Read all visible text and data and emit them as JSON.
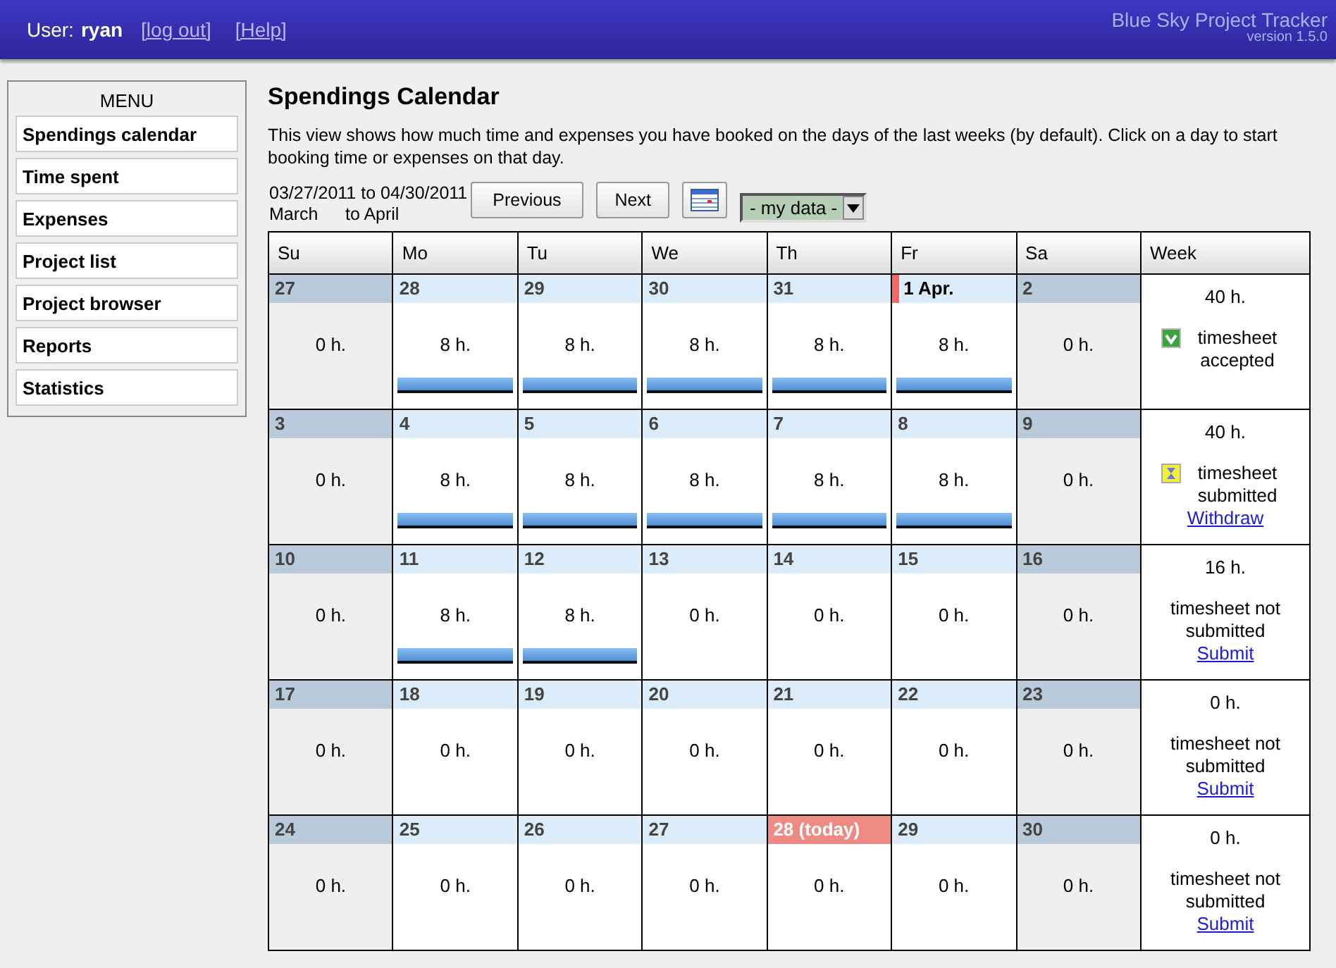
{
  "header": {
    "user_label": "User:",
    "user": "ryan",
    "links": [
      "[log out]",
      "[Help]"
    ],
    "app_name": "Blue Sky Project Tracker",
    "version": "version 1.5.0"
  },
  "menu": {
    "title": "MENU",
    "items": [
      "Spendings calendar",
      "Time spent",
      "Expenses",
      "Project list",
      "Project browser",
      "Reports",
      "Statistics"
    ]
  },
  "page": {
    "title": "Spendings Calendar",
    "description": "This view shows how much time and expenses you have booked on the days of the last weeks (by default). Click on a day to start booking time or expenses on that day."
  },
  "range": {
    "dates": "03/27/2011 to 04/30/2011",
    "from_month": "March",
    "to_month": "to April"
  },
  "buttons": [
    "Previous",
    "Next"
  ],
  "filter": {
    "value": "- my data -"
  },
  "columns": [
    "Su",
    "Mo",
    "Tu",
    "We",
    "Th",
    "Fr",
    "Sa",
    "Week"
  ],
  "weeks": [
    {
      "days": [
        {
          "date": "27",
          "kind": "weekend",
          "hours": "0 h.",
          "booked": false
        },
        {
          "date": "28",
          "kind": "weekday",
          "hours": "8 h.",
          "booked": true
        },
        {
          "date": "29",
          "kind": "weekday",
          "hours": "8 h.",
          "booked": true
        },
        {
          "date": "30",
          "kind": "weekday",
          "hours": "8 h.",
          "booked": true
        },
        {
          "date": "31",
          "kind": "weekday",
          "hours": "8 h.",
          "booked": true
        },
        {
          "date": "1 Apr.",
          "kind": "month_start",
          "hours": "8 h.",
          "booked": true
        },
        {
          "date": "2",
          "kind": "weekend",
          "hours": "0 h.",
          "booked": false
        }
      ],
      "total": "40 h.",
      "kind": "accepted",
      "status_text": "timesheet accepted"
    },
    {
      "days": [
        {
          "date": "3",
          "kind": "weekend",
          "hours": "0 h.",
          "booked": false
        },
        {
          "date": "4",
          "kind": "weekday",
          "hours": "8 h.",
          "booked": true
        },
        {
          "date": "5",
          "kind": "weekday",
          "hours": "8 h.",
          "booked": true
        },
        {
          "date": "6",
          "kind": "weekday",
          "hours": "8 h.",
          "booked": true
        },
        {
          "date": "7",
          "kind": "weekday",
          "hours": "8 h.",
          "booked": true
        },
        {
          "date": "8",
          "kind": "weekday",
          "hours": "8 h.",
          "booked": true
        },
        {
          "date": "9",
          "kind": "weekend",
          "hours": "0 h.",
          "booked": false
        }
      ],
      "total": "40 h.",
      "kind": "submitted",
      "status_text": "timesheet submitted",
      "action": "Withdraw"
    },
    {
      "days": [
        {
          "date": "10",
          "kind": "weekend",
          "hours": "0 h.",
          "booked": false
        },
        {
          "date": "11",
          "kind": "weekday",
          "hours": "8 h.",
          "booked": true
        },
        {
          "date": "12",
          "kind": "weekday",
          "hours": "8 h.",
          "booked": true
        },
        {
          "date": "13",
          "kind": "weekday",
          "hours": "0 h.",
          "booked": false
        },
        {
          "date": "14",
          "kind": "weekday",
          "hours": "0 h.",
          "booked": false
        },
        {
          "date": "15",
          "kind": "weekday",
          "hours": "0 h.",
          "booked": false
        },
        {
          "date": "16",
          "kind": "weekend",
          "hours": "0 h.",
          "booked": false
        }
      ],
      "total": "16 h.",
      "kind": "open",
      "status_text": "timesheet not submitted",
      "action": "Submit"
    },
    {
      "days": [
        {
          "date": "17",
          "kind": "weekend",
          "hours": "0 h.",
          "booked": false
        },
        {
          "date": "18",
          "kind": "weekday",
          "hours": "0 h.",
          "booked": false
        },
        {
          "date": "19",
          "kind": "weekday",
          "hours": "0 h.",
          "booked": false
        },
        {
          "date": "20",
          "kind": "weekday",
          "hours": "0 h.",
          "booked": false
        },
        {
          "date": "21",
          "kind": "weekday",
          "hours": "0 h.",
          "booked": false
        },
        {
          "date": "22",
          "kind": "weekday",
          "hours": "0 h.",
          "booked": false
        },
        {
          "date": "23",
          "kind": "weekend",
          "hours": "0 h.",
          "booked": false
        }
      ],
      "total": "0 h.",
      "kind": "open",
      "status_text": "timesheet not submitted",
      "action": "Submit"
    },
    {
      "days": [
        {
          "date": "24",
          "kind": "weekend",
          "hours": "0 h.",
          "booked": false
        },
        {
          "date": "25",
          "kind": "weekday",
          "hours": "0 h.",
          "booked": false
        },
        {
          "date": "26",
          "kind": "weekday",
          "hours": "0 h.",
          "booked": false
        },
        {
          "date": "27",
          "kind": "weekday",
          "hours": "0 h.",
          "booked": false
        },
        {
          "date": "28 (today)",
          "kind": "today",
          "hours": "0 h.",
          "booked": false
        },
        {
          "date": "29",
          "kind": "weekday",
          "hours": "0 h.",
          "booked": false
        },
        {
          "date": "30",
          "kind": "weekend",
          "hours": "0 h.",
          "booked": false
        }
      ],
      "total": "0 h.",
      "kind": "open",
      "status_text": "timesheet not submitted",
      "action": "Submit"
    }
  ]
}
